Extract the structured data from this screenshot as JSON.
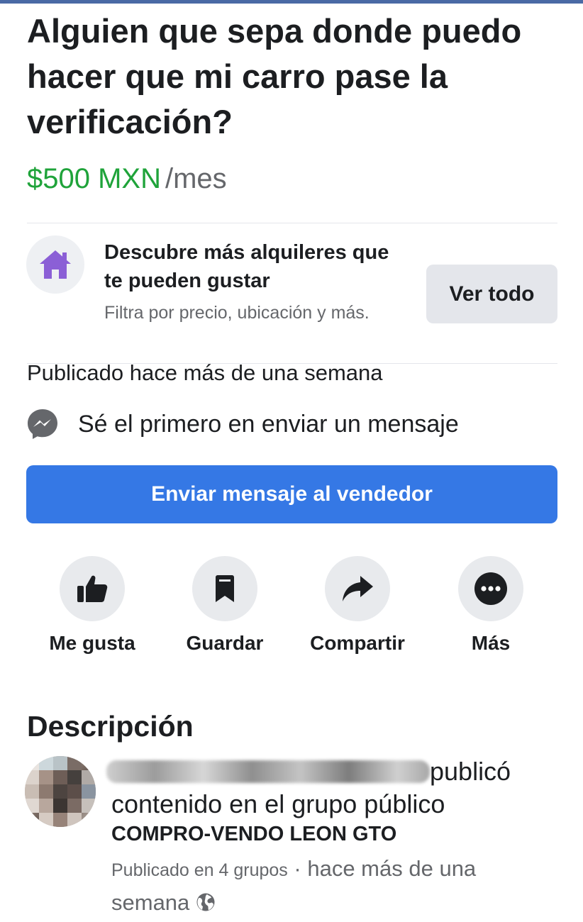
{
  "listing": {
    "title": "Alguien que sepa donde puedo hacer que mi carro pase la verificación?",
    "price": "$500 MXN",
    "price_period": "/mes",
    "accent_color": "#1fa33a"
  },
  "rentals_promo": {
    "icon": "house-icon",
    "title": "Descubre más alquileres que te pueden gustar",
    "subtitle": "Filtra por precio, ubicación y más.",
    "button_label": "Ver todo"
  },
  "posted_text": "Publicado hace más de una semana",
  "messenger": {
    "icon": "messenger-icon",
    "text": "Sé el primero en enviar un mensaje",
    "send_button": "Enviar mensaje al vendedor",
    "button_color": "#3578e5"
  },
  "actions": [
    {
      "label": "Me gusta",
      "icon": "thumbs-up-icon"
    },
    {
      "label": "Guardar",
      "icon": "bookmark-icon"
    },
    {
      "label": "Compartir",
      "icon": "share-icon"
    },
    {
      "label": "Más",
      "icon": "more-icon"
    }
  ],
  "description": {
    "heading": "Descripción",
    "author_published": "publicó",
    "content_line": "contenido en el grupo público",
    "group_name": "COMPRO-VENDO LEON GTO",
    "meta_groups": "Publicado en 4 grupos",
    "meta_time": " · hace más de una semana",
    "privacy_icon": "globe-icon"
  }
}
